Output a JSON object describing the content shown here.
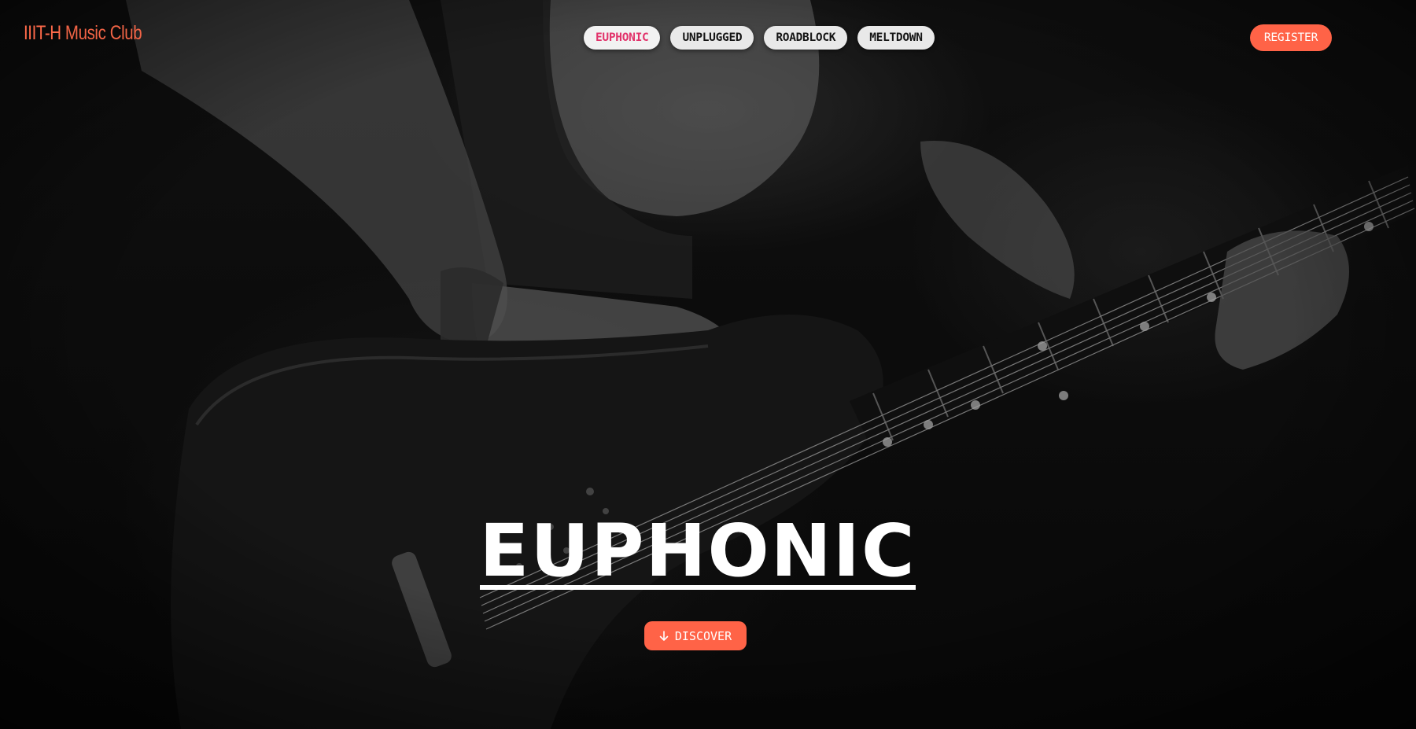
{
  "brand": {
    "prefix": "IIIT-H",
    "suffix": " Music Club"
  },
  "nav": {
    "items": [
      {
        "label": "EUPHONIC",
        "active": true
      },
      {
        "label": "UNPLUGGED",
        "active": false
      },
      {
        "label": "ROADBLOCK",
        "active": false
      },
      {
        "label": "MELTDOWN",
        "active": false
      }
    ]
  },
  "header": {
    "register_label": "REGISTER"
  },
  "hero": {
    "title": "EUPHONIC",
    "discover_label": "DISCOVER",
    "discover_icon": "arrow-down-icon",
    "background_image": "guitarist-playing-electric-guitar-bw-photo"
  },
  "colors": {
    "accent": "#ff6347",
    "active_nav_text": "#e2336b",
    "pill_bg": "#e9e9e9",
    "text_light": "#ffffff"
  }
}
